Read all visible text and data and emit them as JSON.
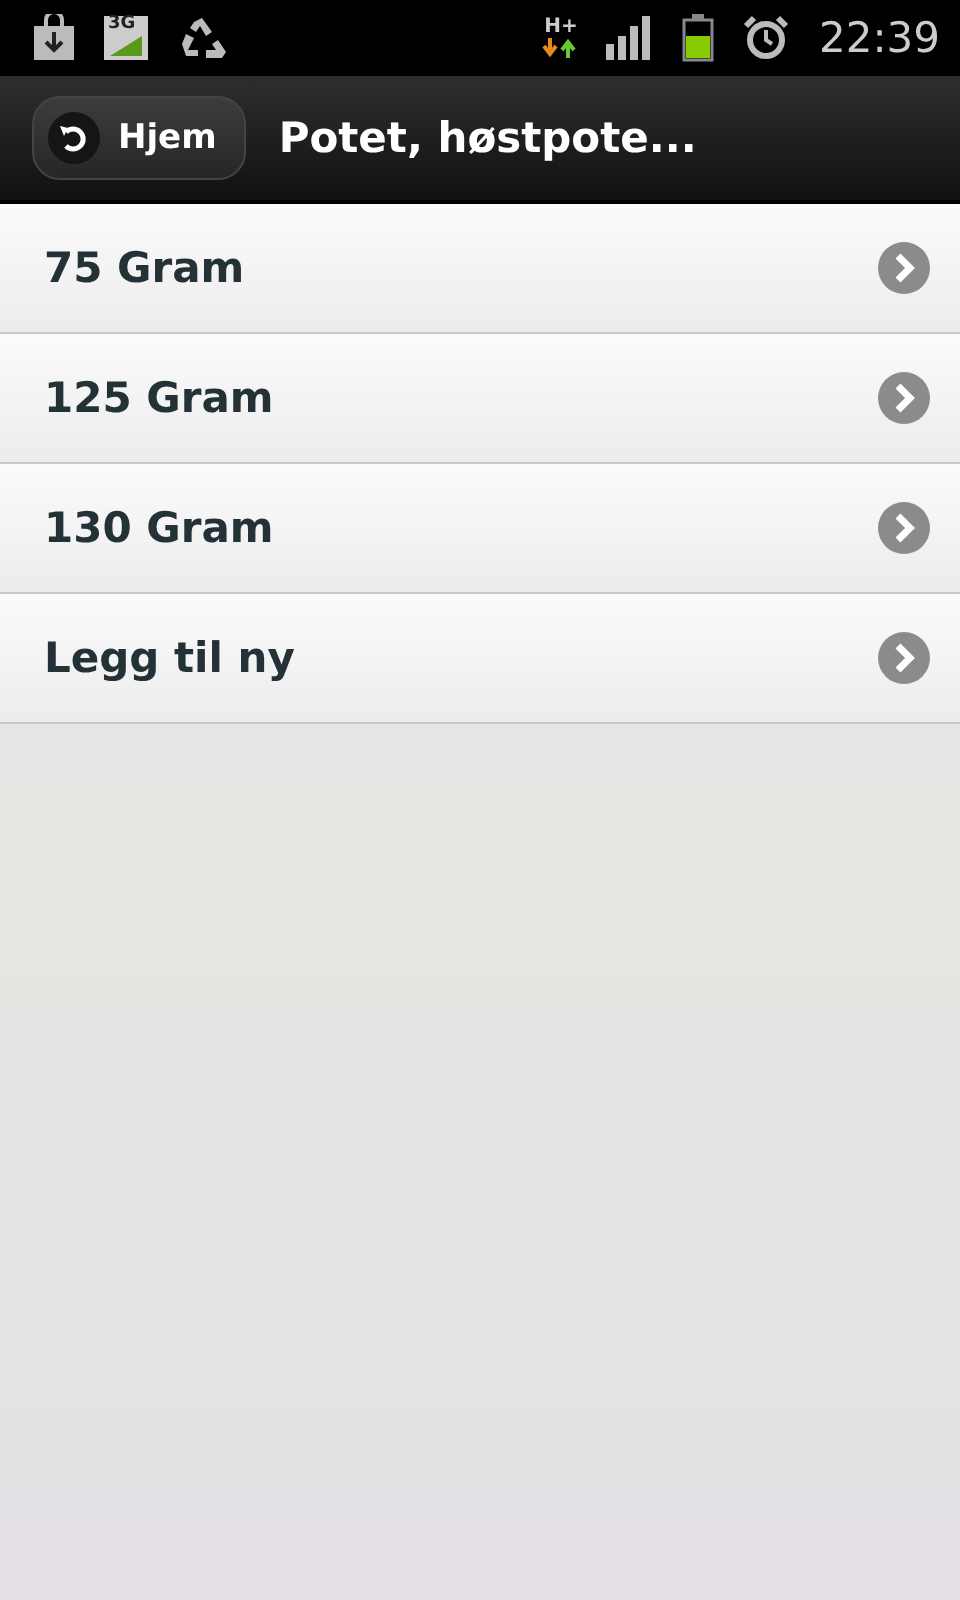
{
  "status_bar": {
    "network_label": "3G",
    "data_label": "H+",
    "time": "22:39"
  },
  "header": {
    "back_button": "Hjem",
    "title": "Potet, høstpote..."
  },
  "items": [
    {
      "label": "75 Gram"
    },
    {
      "label": "125 Gram"
    },
    {
      "label": "130 Gram"
    },
    {
      "label": "Legg til ny"
    }
  ]
}
